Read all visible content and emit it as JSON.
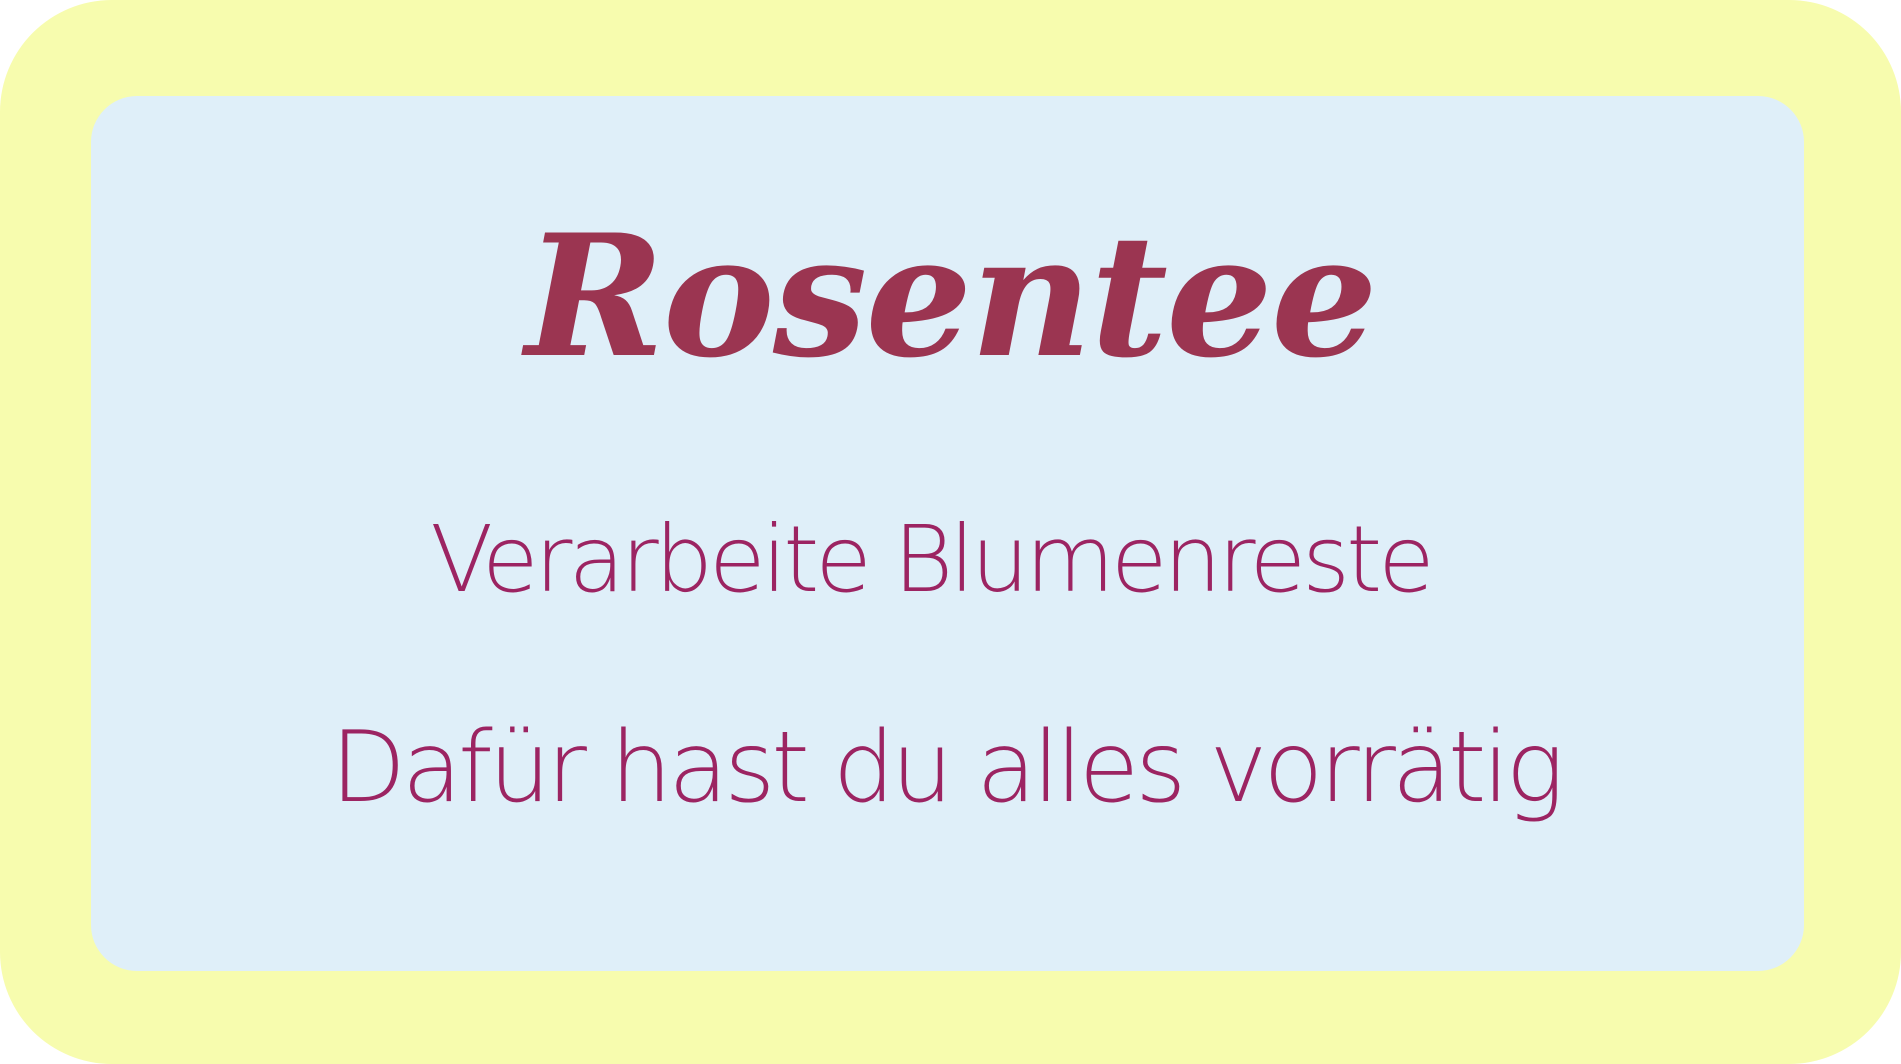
{
  "card": {
    "title": "Rosentee",
    "line1": "Verarbeite Blumenreste",
    "line2": "Dafür hast du alles vorrätig"
  },
  "colors": {
    "outer_frame": "#f7fcae",
    "inner_card": "#dfeff9",
    "title": "#9b3551",
    "text": "#9c2462"
  }
}
